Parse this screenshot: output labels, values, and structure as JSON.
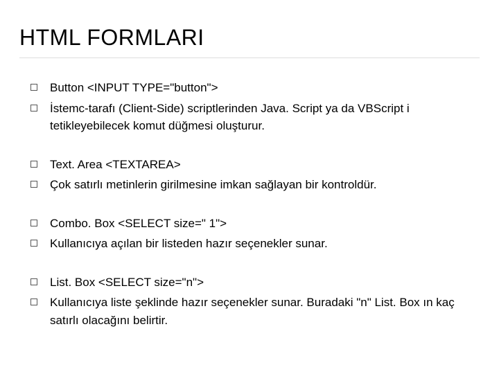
{
  "title": "HTML FORMLARI",
  "groups": [
    {
      "lines": [
        "Button <INPUT TYPE=\"button\">",
        "İstemc-tarafı (Client-Side) scriptlerinden Java. Script ya da VBScript i tetikleyebilecek komut düğmesi oluşturur."
      ]
    },
    {
      "lines": [
        "Text. Area <TEXTAREA>",
        "Çok satırlı metinlerin girilmesine imkan sağlayan bir kontroldür."
      ]
    },
    {
      "lines": [
        "Combo. Box <SELECT size=\" 1\">",
        "Kullanıcıya açılan bir listeden hazır seçenekler sunar."
      ]
    },
    {
      "lines": [
        "List. Box <SELECT size=\"n\">",
        "Kullanıcıya liste şeklinde hazır seçenekler sunar. Buradaki \"n\" List. Box ın kaç satırlı olacağını belirtir."
      ]
    }
  ]
}
